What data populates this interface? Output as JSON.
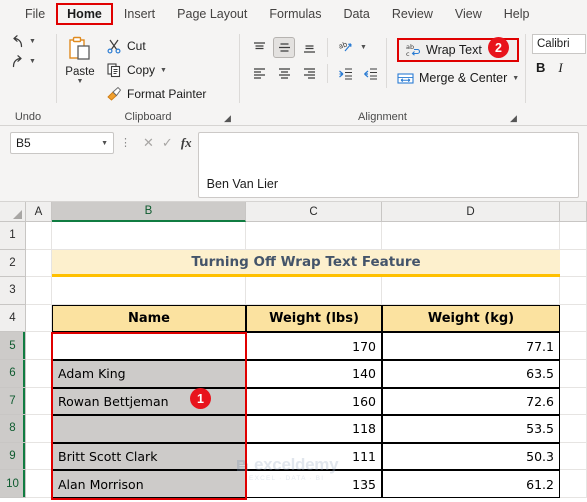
{
  "ribbon": {
    "tabs": [
      {
        "label": "File",
        "active": false
      },
      {
        "label": "Home",
        "active": true
      },
      {
        "label": "Insert",
        "active": false
      },
      {
        "label": "Page Layout",
        "active": false
      },
      {
        "label": "Formulas",
        "active": false
      },
      {
        "label": "Data",
        "active": false
      },
      {
        "label": "Review",
        "active": false
      },
      {
        "label": "View",
        "active": false
      },
      {
        "label": "Help",
        "active": false
      }
    ],
    "groups": {
      "undo": {
        "label": "Undo"
      },
      "clipboard": {
        "label": "Clipboard",
        "paste_label": "Paste",
        "cut_label": "Cut",
        "copy_label": "Copy",
        "format_painter_label": "Format Painter"
      },
      "alignment": {
        "label": "Alignment",
        "wrap_text_label": "Wrap Text",
        "merge_center_label": "Merge & Center"
      },
      "font": {
        "font_name": "Calibri",
        "bold_label": "B",
        "italic_label": "I"
      }
    },
    "callouts": [
      {
        "number": "2",
        "target": "wrap-text-button"
      }
    ]
  },
  "formula_bar": {
    "name_box_value": "B5",
    "cancel_icon": "cancel-icon",
    "enter_icon": "enter-icon",
    "function_icon": "fx",
    "formula_value": "Ben Van Lier"
  },
  "grid": {
    "columns": [
      "A",
      "B",
      "C",
      "D"
    ],
    "selected_column": "B",
    "rows": [
      "1",
      "2",
      "3",
      "4",
      "5",
      "6",
      "7",
      "8",
      "9",
      "10"
    ],
    "selected_rows": [
      "5",
      "6",
      "7",
      "8",
      "9",
      "10"
    ],
    "title": "Turning Off Wrap Text Feature",
    "headers": [
      "Name",
      "Weight (lbs)",
      "Weight (kg)"
    ],
    "data": [
      {
        "row": "5",
        "name": "",
        "lbs": "170",
        "kg": "77.1",
        "active": true
      },
      {
        "row": "6",
        "name": "Adam King",
        "lbs": "140",
        "kg": "63.5",
        "active": false
      },
      {
        "row": "7",
        "name": "Rowan Bettjeman",
        "lbs": "160",
        "kg": "72.6",
        "active": false
      },
      {
        "row": "8",
        "name": "",
        "lbs": "118",
        "kg": "53.5",
        "active": false
      },
      {
        "row": "9",
        "name": "Britt Scott Clark",
        "lbs": "111",
        "kg": "50.3",
        "active": false
      },
      {
        "row": "10",
        "name": "Alan Morrison",
        "lbs": "135",
        "kg": "61.2",
        "active": false
      }
    ],
    "callouts": [
      {
        "number": "1",
        "target": "name-column-selection"
      }
    ]
  },
  "watermark": {
    "name": "exceldemy",
    "tagline": "EXCEL · DATA · BI"
  },
  "colors": {
    "accent_red": "#e00000",
    "badge_red": "#e8141c",
    "excel_green": "#107c41",
    "title_fill": "#fdf0cd",
    "title_border": "#ffc000",
    "header_fill": "#fbe2a0",
    "selection_gray": "#cdcbc9",
    "title_text": "#44546a"
  }
}
